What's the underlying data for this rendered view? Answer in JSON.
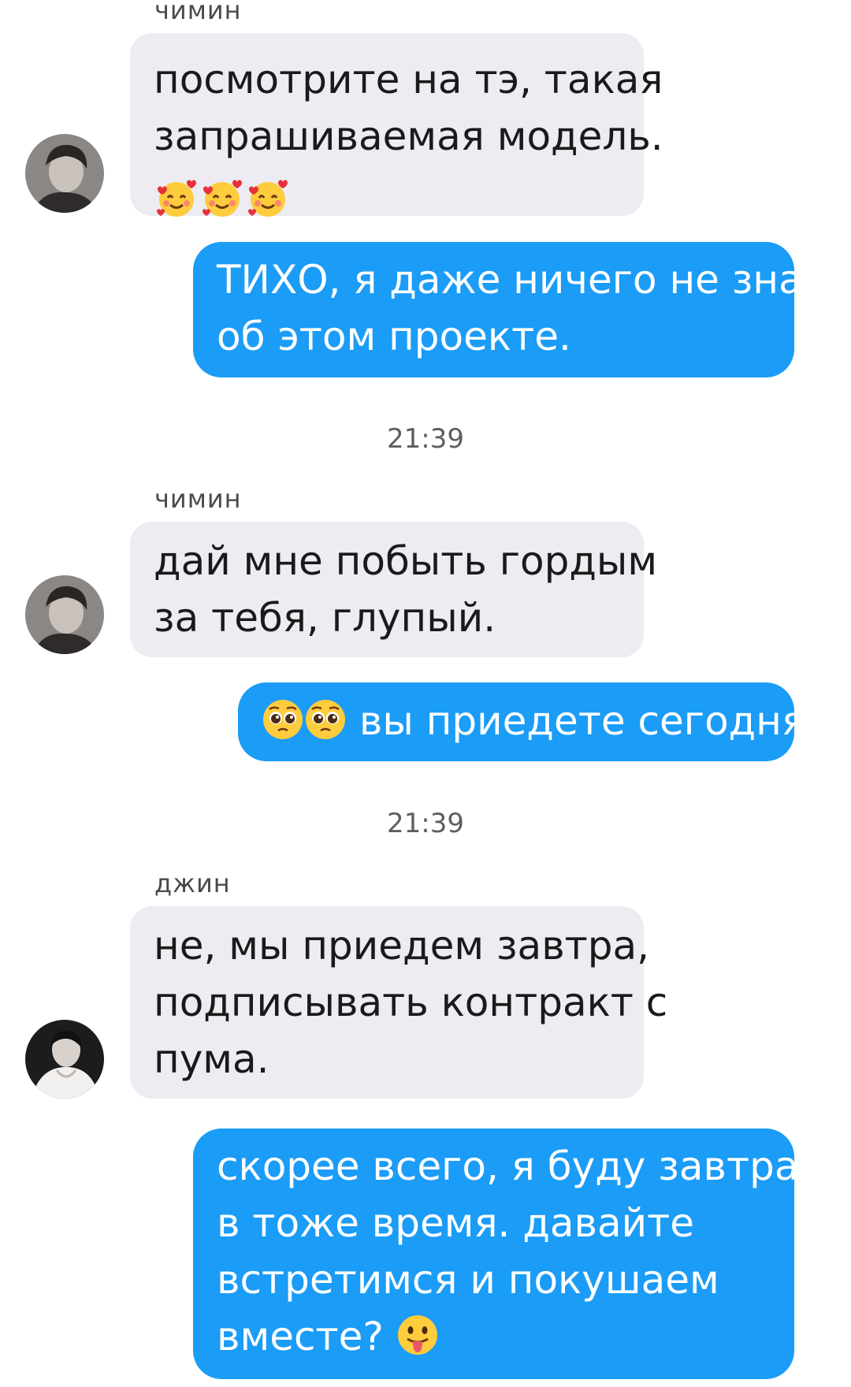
{
  "messages": [
    {
      "sender": "чимин",
      "lines": [
        "посмотрите на тэ, такая",
        "запрашиваемая модель."
      ],
      "emoji": [
        "smiling-face-with-hearts-icon",
        "smiling-face-with-hearts-icon",
        "smiling-face-with-hearts-icon"
      ]
    },
    {
      "lines": [
        "ТИХО, я даже ничего не знаю",
        "об этом проекте."
      ]
    },
    {
      "timestamp": "21:39",
      "sender": "чимин",
      "lines": [
        "дай мне побыть гордым",
        "за тебя, глупый."
      ]
    },
    {
      "emoji": [
        "pleading-face-icon",
        "pleading-face-icon"
      ],
      "text": "вы приедете сегодня?"
    },
    {
      "timestamp": "21:39",
      "sender": "джин",
      "lines": [
        "не, мы приедем завтра,",
        "подписывать контракт с",
        "пума."
      ]
    },
    {
      "lines": [
        "скорее всего, я буду завтра",
        "в тоже время. давайте",
        "встретимся и покушаем",
        "вместе?"
      ],
      "emoji": [
        "face-with-tongue-icon"
      ]
    }
  ],
  "colors": {
    "incoming_bubble": "#ececf2",
    "outgoing_bubble": "#1a9cf7",
    "outgoing_text": "#ffffff",
    "incoming_text": "#1a1a1a",
    "meta_text": "#5e5e5e"
  }
}
